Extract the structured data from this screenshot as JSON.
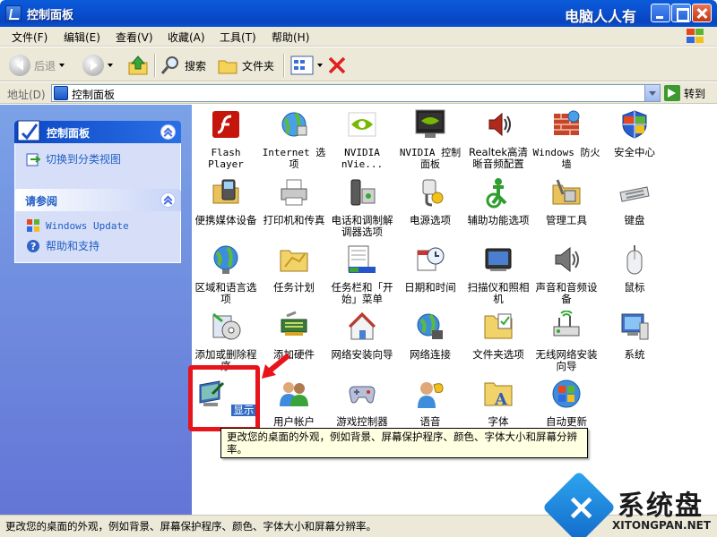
{
  "window": {
    "title": "控制面板",
    "watermark": "电脑人人有"
  },
  "menu": [
    "文件(F)",
    "编辑(E)",
    "查看(V)",
    "收藏(A)",
    "工具(T)",
    "帮助(H)"
  ],
  "toolbar": {
    "back": "后退",
    "search": "搜索",
    "folders": "文件夹"
  },
  "address": {
    "label": "地址(D)",
    "value": "控制面板",
    "go": "转到"
  },
  "left": {
    "panel1": {
      "title": "控制面板",
      "task": "切换到分类视图"
    },
    "panel2": {
      "title": "请参阅",
      "items": [
        "Windows Update",
        "帮助和支持"
      ]
    }
  },
  "icons": [
    {
      "label": "Flash Player",
      "icon": "flash-icon"
    },
    {
      "label": "Internet 选项",
      "icon": "internet-options-icon"
    },
    {
      "label": "NVIDIA nVie...",
      "icon": "nvidia-icon"
    },
    {
      "label": "NVIDIA 控制面板",
      "icon": "nvidia-panel-icon"
    },
    {
      "label": "Realtek高清晰音频配置",
      "icon": "speaker-icon"
    },
    {
      "label": "Windows 防火墙",
      "icon": "firewall-icon"
    },
    {
      "label": "安全中心",
      "icon": "shield-icon"
    },
    {
      "label": "便携媒体设备",
      "icon": "media-device-icon"
    },
    {
      "label": "打印机和传真",
      "icon": "printer-icon"
    },
    {
      "label": "电话和调制解调器选项",
      "icon": "phone-icon"
    },
    {
      "label": "电源选项",
      "icon": "power-icon"
    },
    {
      "label": "辅助功能选项",
      "icon": "accessibility-icon"
    },
    {
      "label": "管理工具",
      "icon": "admin-tools-icon"
    },
    {
      "label": "键盘",
      "icon": "keyboard-icon"
    },
    {
      "label": "区域和语言选项",
      "icon": "globe-icon"
    },
    {
      "label": "任务计划",
      "icon": "task-folder-icon"
    },
    {
      "label": "任务栏和「开始」菜单",
      "icon": "taskbar-icon"
    },
    {
      "label": "日期和时间",
      "icon": "clock-icon"
    },
    {
      "label": "扫描仪和照相机",
      "icon": "scanner-icon"
    },
    {
      "label": "声音和音频设备",
      "icon": "sound-icon"
    },
    {
      "label": "鼠标",
      "icon": "mouse-icon"
    },
    {
      "label": "添加或删除程序",
      "icon": "add-remove-icon"
    },
    {
      "label": "添加硬件",
      "icon": "hardware-icon"
    },
    {
      "label": "网络安装向导",
      "icon": "network-wizard-icon"
    },
    {
      "label": "网络连接",
      "icon": "network-icon"
    },
    {
      "label": "文件夹选项",
      "icon": "folder-options-icon"
    },
    {
      "label": "无线网络安装向导",
      "icon": "wireless-icon"
    },
    {
      "label": "系统",
      "icon": "system-icon"
    },
    {
      "label": "显示",
      "icon": "display-icon"
    },
    {
      "label": "用户帐户",
      "icon": "users-icon"
    },
    {
      "label": "游戏控制器",
      "icon": "gamepad-icon"
    },
    {
      "label": "语音",
      "icon": "speech-icon"
    },
    {
      "label": "字体",
      "icon": "fonts-icon"
    },
    {
      "label": "自动更新",
      "icon": "update-icon"
    }
  ],
  "tooltip": "更改您的桌面的外观，例如背景、屏幕保护程序、颜色、字体大小和屏幕分辨率。",
  "status": "更改您的桌面的外观，例如背景、屏幕保护程序、颜色、字体大小和屏幕分辨率。",
  "brand": {
    "name": "系统盘",
    "url": "XITONGPAN.NET"
  }
}
